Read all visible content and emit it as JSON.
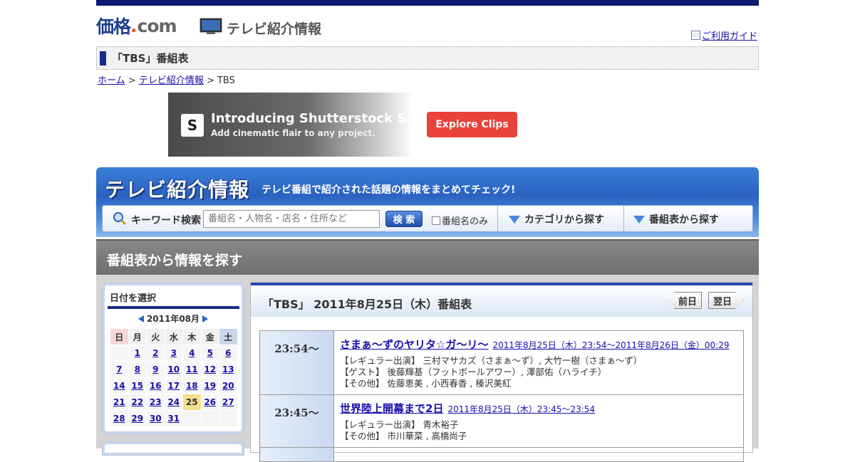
{
  "header": {
    "logo_main": "価格",
    "logo_dot": ".",
    "logo_com": "com",
    "section_label": "テレビ紹介情報",
    "guide_link": "ご利用ガイド"
  },
  "page_title": "「TBS」番組表",
  "breadcrumb": {
    "home": "ホーム",
    "sep1": ">",
    "tv_info": "テレビ紹介情報",
    "sep2": "> TBS"
  },
  "ad": {
    "logo_letter": "S",
    "headline": "Introducing Shutterstock Select",
    "subline": "Add cinematic flair to any project.",
    "button": "Explore Clips"
  },
  "banner": {
    "title": "テレビ紹介情報",
    "subtitle": "テレビ番組で紹介された話題の情報をまとめてチェック!",
    "keyword_label": "キーワード検索",
    "search_placeholder": "番組名・人物名・店名・住所など",
    "search_button": "検 索",
    "program_only_label": "番組名のみ",
    "category_link": "カテゴリから探す",
    "schedule_link": "番組表から探す"
  },
  "section_title": "番組表から情報を探す",
  "calendar": {
    "heading": "日付を選択",
    "month": "2011年08月",
    "weekdays": [
      "日",
      "月",
      "火",
      "水",
      "木",
      "金",
      "土"
    ],
    "weeks": [
      [
        "",
        "1",
        "2",
        "3",
        "4",
        "5",
        "6"
      ],
      [
        "7",
        "8",
        "9",
        "10",
        "11",
        "12",
        "13"
      ],
      [
        "14",
        "15",
        "16",
        "17",
        "18",
        "19",
        "20"
      ],
      [
        "21",
        "22",
        "23",
        "24",
        "25",
        "26",
        "27"
      ],
      [
        "28",
        "29",
        "30",
        "31",
        "",
        "",
        ""
      ]
    ],
    "selected_day": "25"
  },
  "schedule": {
    "heading": "「TBS」 2011年8月25日（木）番組表",
    "prev_label": "前日",
    "next_label": "翌日",
    "programs": [
      {
        "time": "23:54～",
        "title": "さまぁ～ずのヤリタ☆ガ～リ～",
        "datetime": "2011年8月25日（木）23:54～2011年8月26日（金）00:29",
        "lines": [
          "【レギュラー出演】 三村マサカズ（さまぁ～ず）, 大竹一樹（さまぁ～ず）",
          "【ゲスト】 後藤輝基（フットボールアワー）, 澤部佑（ハライチ）",
          "【その他】 佐藤恵美 , 小西春香 , 榛沢美紅"
        ]
      },
      {
        "time": "23:45～",
        "title": "世界陸上開幕まで2日",
        "datetime": "2011年8月25日（木）23:45～23:54",
        "lines": [
          "【レギュラー出演】 青木裕子",
          "【その他】 市川華菜 , 高橋尚子"
        ]
      }
    ]
  },
  "colors": {
    "navy": "#0a1a6e",
    "banner_blue": "#2a62c0",
    "link": "#1a0dab",
    "ad_button": "#e8423a",
    "today_highlight": "#f2e08e"
  }
}
